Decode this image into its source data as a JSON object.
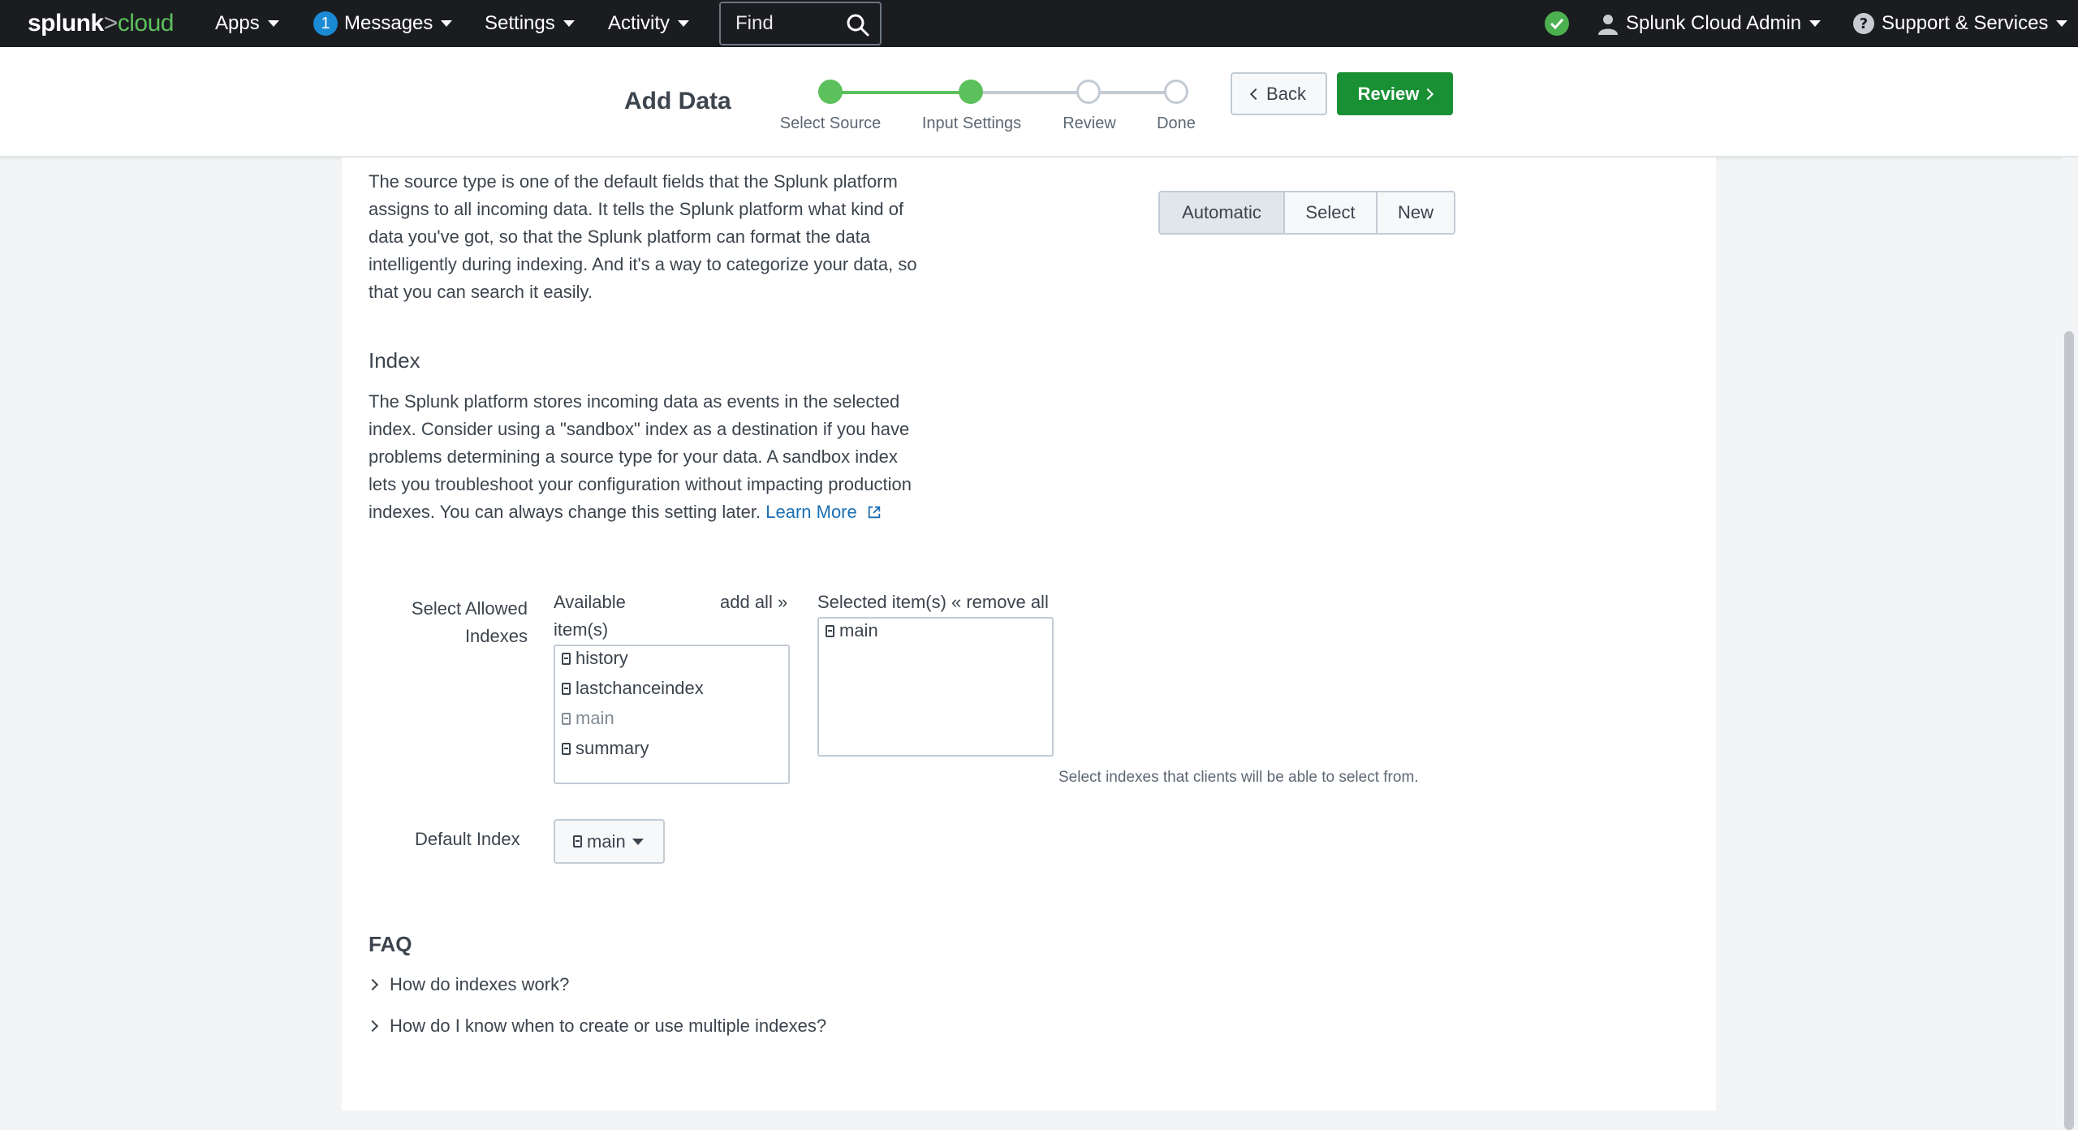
{
  "nav": {
    "logo_brand": "splunk",
    "logo_sep": ">",
    "logo_product": "cloud",
    "apps": "Apps",
    "messages_count": "1",
    "messages": "Messages",
    "settings": "Settings",
    "activity": "Activity",
    "find_placeholder": "Find",
    "user": "Splunk Cloud Admin",
    "support": "Support & Services",
    "icons": [
      "search-icon",
      "health-status-icon",
      "user-icon",
      "help-icon"
    ]
  },
  "header": {
    "title": "Add Data",
    "steps": [
      {
        "label": "Select Source",
        "state": "complete"
      },
      {
        "label": "Input Settings",
        "state": "current"
      },
      {
        "label": "Review",
        "state": "pending"
      },
      {
        "label": "Done",
        "state": "pending"
      }
    ],
    "back_label": "Back",
    "review_label": "Review",
    "accent_color": "#5cc05c",
    "primary_color": "#1a9035"
  },
  "sourcetype": {
    "description": "The source type is one of the default fields that the Splunk platform assigns to all incoming data. It tells the Splunk platform what kind of data you've got, so that the Splunk platform can format the data intelligently during indexing. And it's a way to categorize your data, so that you can search it easily.",
    "options": [
      "Automatic",
      "Select",
      "New"
    ],
    "selected": "Automatic"
  },
  "index": {
    "heading": "Index",
    "description": "The Splunk platform stores incoming data as events in the selected index. Consider using a \"sandbox\" index as a destination if you have problems determining a source type for your data. A sandbox index lets you troubleshoot your configuration without impacting production indexes. You can always change this setting later.",
    "learn_more": "Learn More",
    "allowed_label": "Select Allowed Indexes",
    "available_label": "Available item(s)",
    "add_all": "add all »",
    "selected_label": "Selected item(s)",
    "remove_all": "« remove all",
    "available": [
      {
        "name": "history",
        "disabled": false
      },
      {
        "name": "lastchanceindex",
        "disabled": false
      },
      {
        "name": "main",
        "disabled": true
      },
      {
        "name": "summary",
        "disabled": false
      }
    ],
    "selected": [
      "main"
    ],
    "help": "Select indexes that clients will be able to select from.",
    "default_label": "Default Index",
    "default_value": "main"
  },
  "faq": {
    "heading": "FAQ",
    "items": [
      "How do indexes work?",
      "How do I know when to create or use multiple indexes?"
    ]
  }
}
